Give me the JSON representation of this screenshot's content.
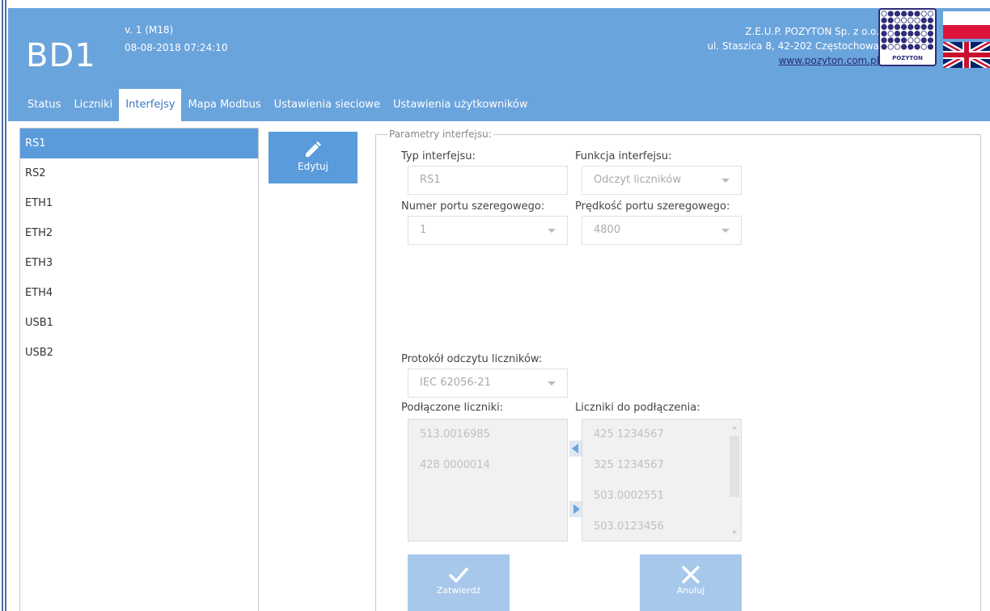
{
  "header": {
    "brand": "BD1",
    "version": "v. 1 (M18)",
    "datetime": "08-08-2018 07:24:10",
    "company_name": "Z.E.U.P. POZYTON Sp. z o.o.",
    "company_address": "ul. Staszica 8, 42-202 Częstochowa",
    "company_link": "www.pozyton.com.pl",
    "logo_text": "POZYTON"
  },
  "tabs": [
    {
      "label": "Status",
      "active": false
    },
    {
      "label": "Liczniki",
      "active": false
    },
    {
      "label": "Interfejsy",
      "active": true
    },
    {
      "label": "Mapa Modbus",
      "active": false
    },
    {
      "label": "Ustawienia sieciowe",
      "active": false
    },
    {
      "label": "Ustawienia użytkowników",
      "active": false
    }
  ],
  "sidebar": {
    "items": [
      {
        "label": "RS1",
        "active": true
      },
      {
        "label": "RS2",
        "active": false
      },
      {
        "label": "ETH1",
        "active": false
      },
      {
        "label": "ETH2",
        "active": false
      },
      {
        "label": "ETH3",
        "active": false
      },
      {
        "label": "ETH4",
        "active": false
      },
      {
        "label": "USB1",
        "active": false
      },
      {
        "label": "USB2",
        "active": false
      }
    ]
  },
  "edit_button": {
    "label": "Edytuj"
  },
  "params": {
    "legend": "Parametry interfejsu:",
    "interface_type_label": "Typ interfejsu:",
    "interface_type_value": "RS1",
    "interface_function_label": "Funkcja interfejsu:",
    "interface_function_value": "Odczyt liczników",
    "serial_port_label": "Numer portu szeregowego:",
    "serial_port_value": "1",
    "serial_speed_label": "Prędkość portu szeregowego:",
    "serial_speed_value": "4800",
    "protocol_label": "Protokół odczytu liczników:",
    "protocol_value": "IEC 62056-21",
    "connected_label": "Podłączone liczniki:",
    "connected": [
      "513.0016985",
      "428 0000014"
    ],
    "available_label": "Liczniki do podłączenia:",
    "available": [
      "425 1234567",
      "325 1234567",
      "503.0002551",
      "503.0123456"
    ]
  },
  "actions": {
    "confirm_label": "Zatwierdź",
    "cancel_label": "Anuluj"
  },
  "colors": {
    "header_bg": "#6aa4dc",
    "active_item": "#5a9bdc",
    "disabled_btn": "#a7c8ea",
    "flag_red": "#dc143c"
  }
}
